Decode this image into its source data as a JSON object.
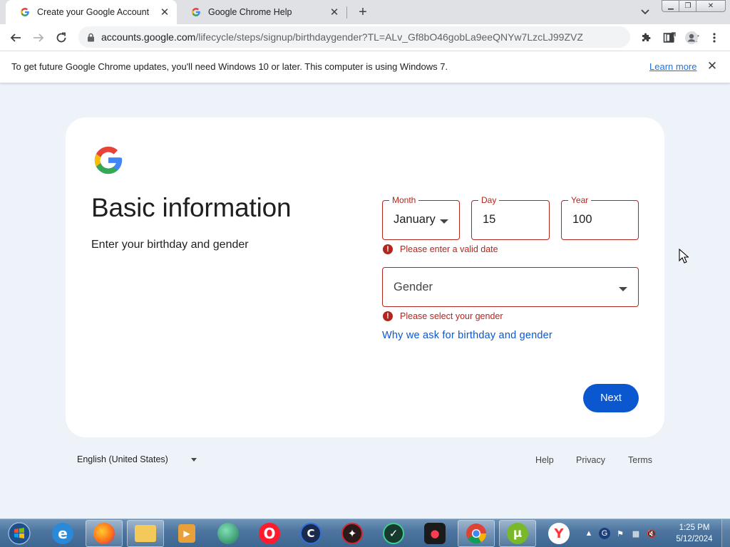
{
  "browser": {
    "tabs": [
      {
        "title": "Create your Google Account",
        "active": true
      },
      {
        "title": "Google Chrome Help",
        "active": false
      }
    ],
    "url_host": "accounts.google.com",
    "url_path": "/lifecycle/steps/signup/birthdaygender?TL=ALv_Gf8bO46gobLa9eeQNYw7LzcLJ99ZVZ...",
    "infobar": {
      "message": "To get future Google Chrome updates, you'll need Windows 10 or later. This computer is using Windows 7.",
      "learn_more": "Learn more"
    }
  },
  "page": {
    "title": "Basic information",
    "subtitle": "Enter your birthday and gender",
    "month": {
      "label": "Month",
      "value": "January"
    },
    "day": {
      "label": "Day",
      "value": "15"
    },
    "year": {
      "label": "Year",
      "value": "100"
    },
    "date_error": "Please enter a valid date",
    "gender": {
      "placeholder": "Gender"
    },
    "gender_error": "Please select your gender",
    "why_link": "Why we ask for birthday and gender",
    "next_label": "Next",
    "error_color": "#b3261e",
    "accent_color": "#0b57d0"
  },
  "footer": {
    "language": "English (United States)",
    "links": {
      "help": "Help",
      "privacy": "Privacy",
      "terms": "Terms"
    }
  },
  "taskbar": {
    "apps": [
      "internet-explorer-icon",
      "firefox-icon",
      "file-explorer-icon",
      "media-player-icon",
      "globe-browser-icon",
      "opera-icon",
      "ccleaner-icon",
      "antivirus-icon",
      "vpn-icon",
      "screen-recorder-icon",
      "chrome-icon",
      "utorrent-icon",
      "yandex-icon"
    ],
    "time": "1:25 PM",
    "date": "5/12/2024"
  }
}
